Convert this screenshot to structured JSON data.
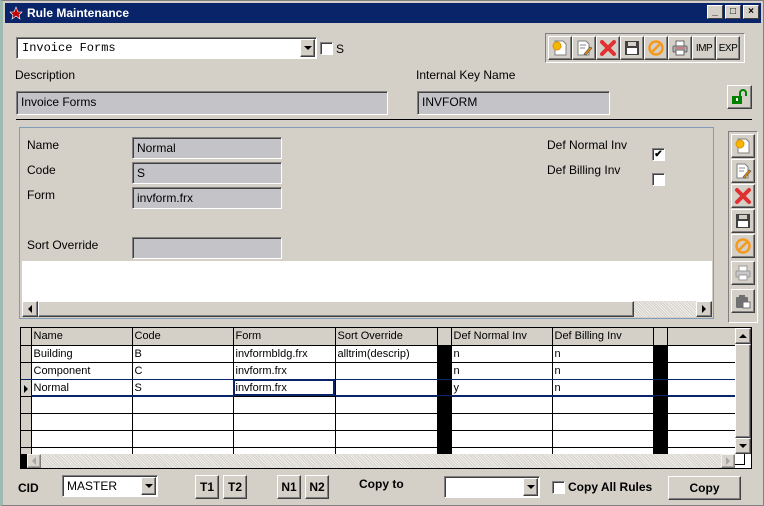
{
  "window": {
    "title": "Rule Maintenance",
    "controls": [
      "_",
      "□",
      "×"
    ]
  },
  "header": {
    "rule_select": {
      "value": "Invoice Forms"
    },
    "s_checkbox": {
      "label": "S",
      "checked": false
    },
    "description_label": "Description",
    "description_value": "Invoice Forms",
    "internal_key_label": "Internal Key Name",
    "internal_key_value": "INVFORM"
  },
  "toolbar": {
    "items": [
      {
        "name": "new",
        "icon": "new-document-icon"
      },
      {
        "name": "edit",
        "icon": "edit-document-icon"
      },
      {
        "name": "delete",
        "icon": "delete-x-icon"
      },
      {
        "name": "save",
        "icon": "floppy-disk-icon"
      },
      {
        "name": "cancel",
        "icon": "cancel-circle-icon"
      },
      {
        "name": "print",
        "icon": "printer-icon"
      }
    ],
    "imp_label": "IMP",
    "exp_label": "EXP"
  },
  "lock": {
    "icon": "unlocked-padlock-icon",
    "state": "unlocked"
  },
  "detail": {
    "name_label": "Name",
    "name_value": "Normal",
    "code_label": "Code",
    "code_value": "S",
    "form_label": "Form",
    "form_value": "invform.frx",
    "sort_override_label": "Sort Override",
    "sort_override_value": "",
    "def_normal_label": "Def Normal Inv",
    "def_normal_checked": true,
    "def_billing_label": "Def Billing Inv",
    "def_billing_checked": false
  },
  "side_toolbar": {
    "items": [
      {
        "name": "new",
        "icon": "new-document-icon"
      },
      {
        "name": "edit",
        "icon": "edit-document-icon"
      },
      {
        "name": "delete",
        "icon": "delete-x-icon"
      },
      {
        "name": "save",
        "icon": "floppy-disk-icon"
      },
      {
        "name": "cancel",
        "icon": "cancel-circle-icon"
      },
      {
        "name": "print",
        "icon": "printer-icon"
      },
      {
        "name": "clipboard",
        "icon": "clipboard-icon"
      }
    ]
  },
  "grid": {
    "columns": [
      "Name",
      "Code",
      "Form",
      "Sort Override",
      "Def Normal Inv",
      "Def Billing Inv"
    ],
    "rows": [
      [
        "Building",
        "B",
        "invformbldg.frx",
        "alltrim(descrip)",
        "n",
        "n"
      ],
      [
        "Component",
        "C",
        "invform.frx",
        "",
        "n",
        "n"
      ],
      [
        "Normal",
        "S",
        "invform.frx",
        "",
        "y",
        "n"
      ]
    ],
    "selected_row": 2
  },
  "footer": {
    "cid_label": "CID",
    "cid_value": "MASTER",
    "t1_label": "T1",
    "t2_label": "T2",
    "n1_label": "N1",
    "n2_label": "N2",
    "copy_to_label": "Copy to",
    "copy_to_value": "",
    "copy_all_label": "Copy All Rules",
    "copy_all_checked": false,
    "copy_button_label": "Copy"
  }
}
